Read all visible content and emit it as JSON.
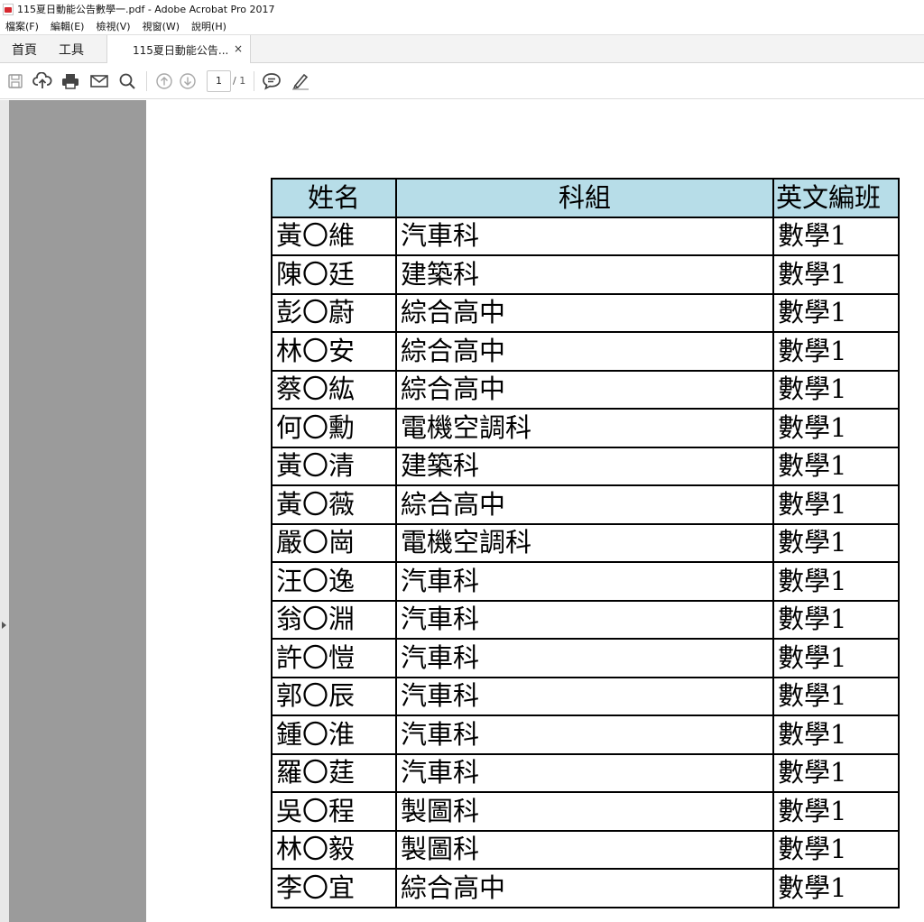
{
  "window": {
    "title": "115夏日動能公告數學一.pdf - Adobe Acrobat Pro 2017"
  },
  "menu": {
    "items": [
      "檔案(F)",
      "編輯(E)",
      "檢視(V)",
      "視窗(W)",
      "說明(H)"
    ]
  },
  "tabs": {
    "home": "首頁",
    "tools": "工具",
    "document": "115夏日動能公告...",
    "close": "×"
  },
  "toolbar": {
    "icons": [
      "save-icon",
      "upload-cloud-icon",
      "print-icon",
      "email-icon",
      "search-icon",
      "previous-page-icon",
      "next-page-icon",
      "comment-icon",
      "highlight-pen-icon"
    ],
    "page_current": "1",
    "page_total": "/ 1"
  },
  "table": {
    "headers": [
      "姓名",
      "科組",
      "英文編班"
    ],
    "header_bg": "#b7dde8",
    "rows": [
      [
        "黃〇維",
        "汽車科",
        "數學1"
      ],
      [
        "陳〇廷",
        "建築科",
        "數學1"
      ],
      [
        "彭〇蔚",
        "綜合高中",
        "數學1"
      ],
      [
        "林〇安",
        "綜合高中",
        "數學1"
      ],
      [
        "蔡〇紘",
        "綜合高中",
        "數學1"
      ],
      [
        "何〇勳",
        "電機空調科",
        "數學1"
      ],
      [
        "黃〇清",
        "建築科",
        "數學1"
      ],
      [
        "黃〇薇",
        "綜合高中",
        "數學1"
      ],
      [
        "嚴〇崗",
        "電機空調科",
        "數學1"
      ],
      [
        "汪〇逸",
        "汽車科",
        "數學1"
      ],
      [
        "翁〇淵",
        "汽車科",
        "數學1"
      ],
      [
        "許〇愷",
        "汽車科",
        "數學1"
      ],
      [
        "郭〇辰",
        "汽車科",
        "數學1"
      ],
      [
        "鍾〇淮",
        "汽車科",
        "數學1"
      ],
      [
        "羅〇莛",
        "汽車科",
        "數學1"
      ],
      [
        "吳〇程",
        "製圖科",
        "數學1"
      ],
      [
        "林〇毅",
        "製圖科",
        "數學1"
      ],
      [
        "李〇宜",
        "綜合高中",
        "數學1"
      ]
    ]
  }
}
